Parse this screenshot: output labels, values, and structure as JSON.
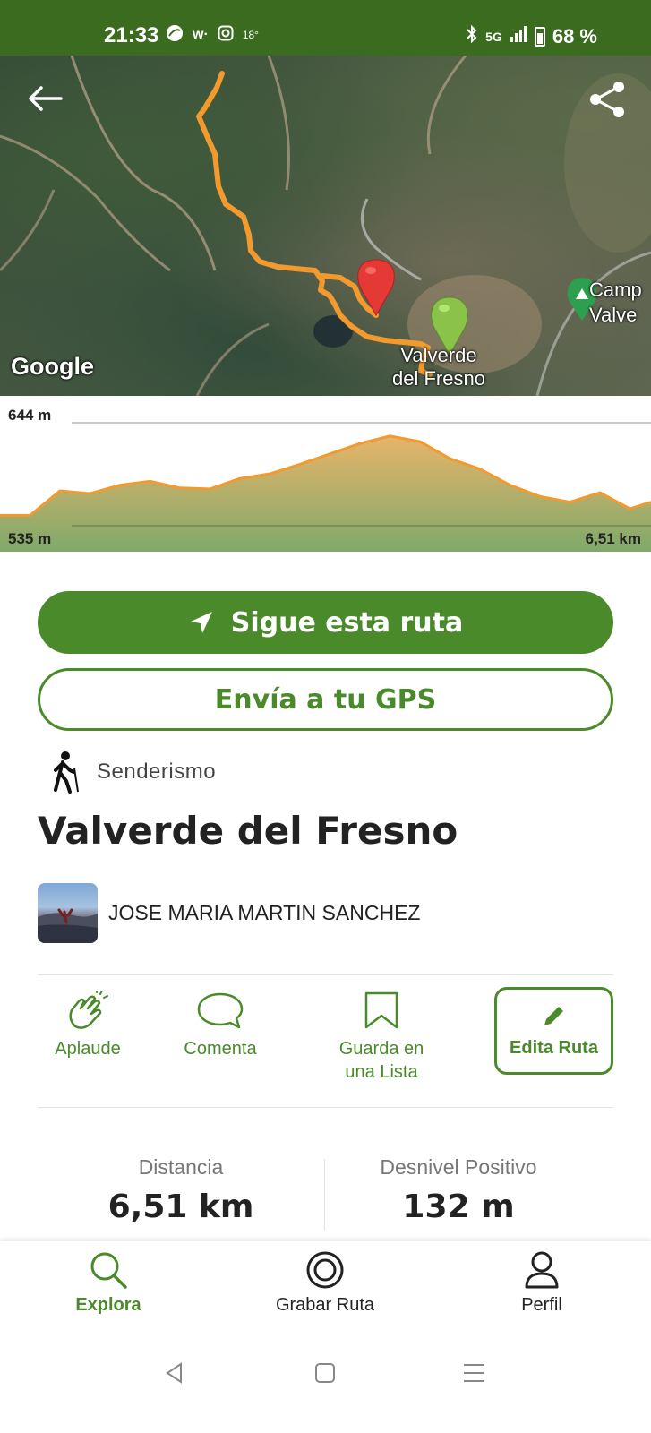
{
  "status_bar": {
    "time": "21:33",
    "temperature": "18°",
    "network": "5G",
    "battery": "68 %",
    "icons": [
      "app-leaf-icon",
      "wallapop-icon",
      "instagram-icon",
      "bluetooth-icon",
      "signal-icon",
      "battery-icon"
    ]
  },
  "map": {
    "attribution": "Google",
    "town_label": "Valverde del Fresno",
    "camp_label": "Camp\nValve",
    "marker_colors": {
      "start": "#e53935",
      "end": "#8bc34a",
      "route": "#f29a2e"
    }
  },
  "elevation": {
    "max": "644 m",
    "min": "535 m",
    "distance": "6,51 km",
    "chart_data": {
      "type": "area",
      "x": [
        0,
        0.3,
        0.6,
        0.9,
        1.2,
        1.5,
        1.8,
        2.1,
        2.4,
        2.7,
        3.0,
        3.3,
        3.6,
        3.9,
        4.2,
        4.5,
        4.8,
        5.1,
        5.4,
        5.7,
        6.0,
        6.3,
        6.51
      ],
      "y": [
        546,
        546,
        572,
        569,
        578,
        582,
        575,
        574,
        585,
        590,
        600,
        611,
        622,
        630,
        624,
        606,
        595,
        578,
        566,
        560,
        570,
        553,
        560
      ],
      "xlim": [
        0,
        6.51
      ],
      "ylim": [
        535,
        644
      ],
      "xlabel": "",
      "ylabel": "",
      "colors": {
        "line": "#f29a2e",
        "fill_top": "#e7b46a",
        "fill_bottom": "#7fa96a"
      }
    }
  },
  "buttons": {
    "follow": "Sigue esta ruta",
    "send_gps": "Envía a tu GPS"
  },
  "route": {
    "activity": "Senderismo",
    "title": "Valverde del Fresno",
    "author": "JOSE MARIA MARTIN SANCHEZ"
  },
  "actions": {
    "applaud": "Aplaude",
    "comment": "Comenta",
    "save_line1": "Guarda en",
    "save_line2": "una Lista",
    "edit": "Edita Ruta"
  },
  "stats": {
    "distance_label": "Distancia",
    "distance_value": "6,51 km",
    "elevation_label": "Desnivel Positivo",
    "elevation_value": "132 m"
  },
  "bottom_nav": {
    "explore": "Explora",
    "record": "Grabar Ruta",
    "profile": "Perfil",
    "active": "explore"
  },
  "colors": {
    "brand_green": "#4a8a2a",
    "status_bar": "#3a6b1f"
  }
}
